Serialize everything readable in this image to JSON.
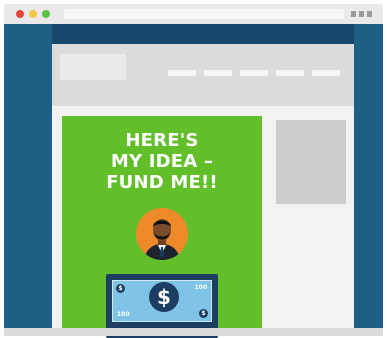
{
  "browser": {
    "traffic_lights": {
      "red": "#e8423a",
      "yellow": "#f2c744",
      "green": "#5cc24a"
    },
    "window_controls_icon": "window-controls-icon"
  },
  "site": {
    "nav_links": 5
  },
  "hero": {
    "headline_lines": [
      "HERE'S",
      "MY IDEA –",
      "FUND ME!!"
    ],
    "background_color": "#62bf2a",
    "avatar_icon": "person-icon",
    "avatar_color": "#ef8a2a"
  },
  "bill": {
    "symbol": "$",
    "corner_top_left": "$",
    "corner_bottom_right": "$",
    "denomination_top": "100",
    "denomination_bottom": "100"
  }
}
